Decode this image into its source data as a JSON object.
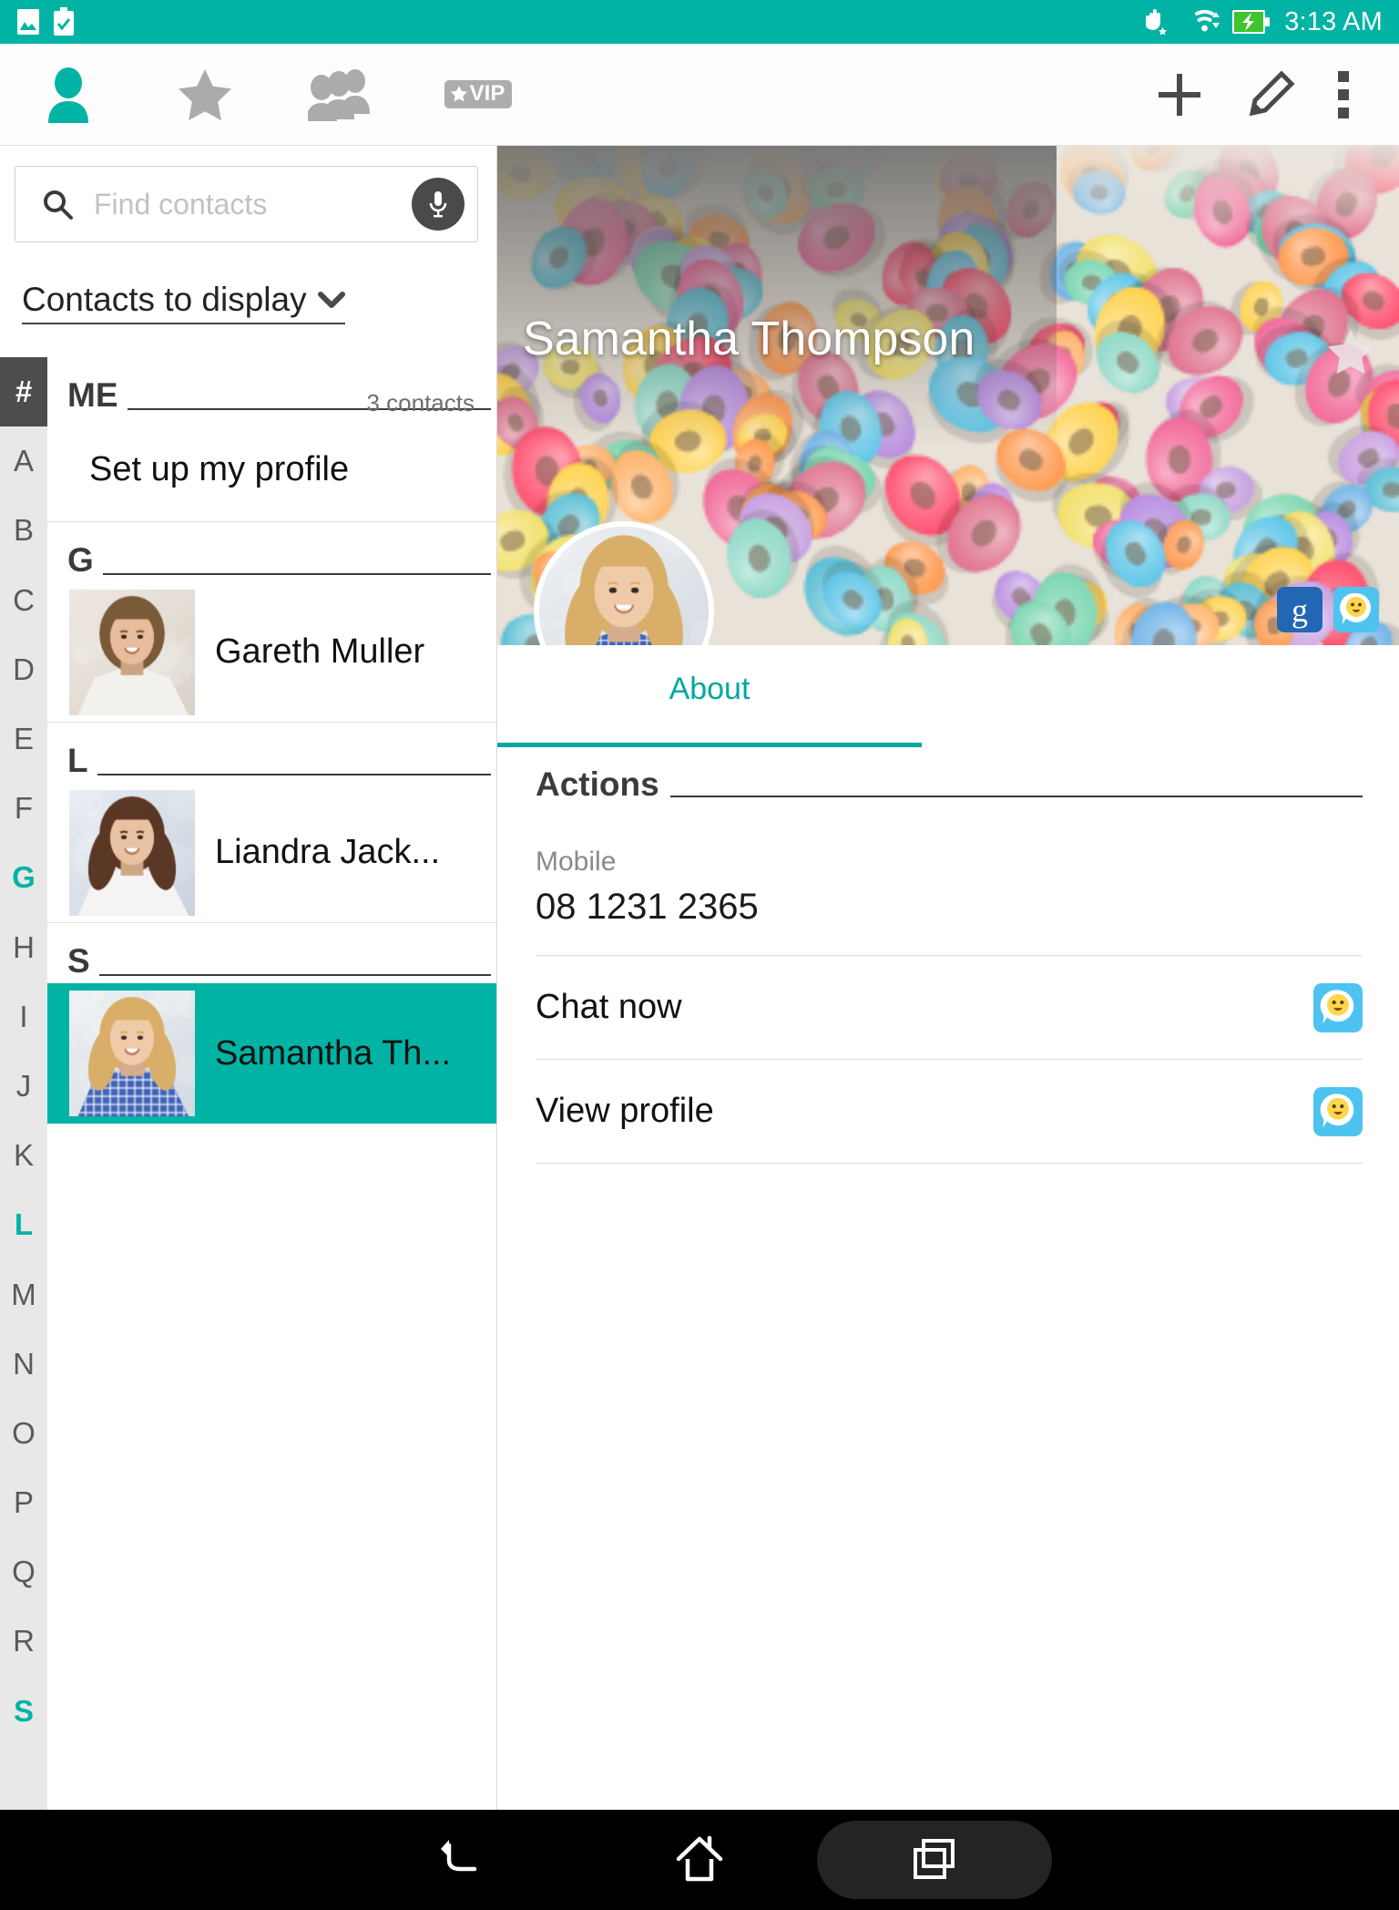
{
  "status_bar": {
    "icons": [
      "gallery-icon",
      "battery-saver-icon"
    ],
    "right_icons": [
      "glove-mode-icon",
      "wifi-icon",
      "battery-charging-icon"
    ],
    "time": "3:13 AM",
    "background_color": "#00B3A4"
  },
  "app_bar": {
    "tabs": [
      {
        "name": "contacts",
        "icon": "person-icon",
        "active": true
      },
      {
        "name": "favorites",
        "icon": "star-icon",
        "active": false
      },
      {
        "name": "groups",
        "icon": "people-icon",
        "active": false
      },
      {
        "name": "vip",
        "icon": "vip-badge-icon",
        "label": "VIP",
        "active": false
      }
    ],
    "actions": [
      {
        "name": "add-contact",
        "icon": "plus-icon"
      },
      {
        "name": "edit-contact",
        "icon": "pencil-icon"
      },
      {
        "name": "overflow-menu",
        "icon": "more-vertical-icon"
      }
    ],
    "accent_color": "#00B3A4"
  },
  "search": {
    "placeholder": "Find contacts",
    "value": "",
    "icon": "search-icon",
    "mic_icon": "microphone-icon"
  },
  "display_filter": {
    "label": "Contacts to display",
    "chevron": "chevron-down-icon"
  },
  "alpha_index": {
    "letters": [
      "#",
      "A",
      "B",
      "C",
      "D",
      "E",
      "F",
      "G",
      "H",
      "I",
      "J",
      "K",
      "L",
      "M",
      "N",
      "O",
      "P",
      "Q",
      "R",
      "S"
    ],
    "selected": [
      "G",
      "L",
      "S"
    ],
    "highlighted": "#",
    "accent_color": "#00B3A4"
  },
  "contact_list": {
    "sections": [
      {
        "letter": "ME",
        "count_label": "3 contacts",
        "items": [
          {
            "name": "Set up my profile",
            "has_photo": false
          }
        ]
      },
      {
        "letter": "G",
        "count_label": "",
        "items": [
          {
            "name": "Gareth Muller",
            "has_photo": true,
            "photo": "gareth"
          }
        ]
      },
      {
        "letter": "L",
        "count_label": "",
        "items": [
          {
            "name": "Liandra Jack...",
            "has_photo": true,
            "photo": "liandra"
          }
        ]
      },
      {
        "letter": "S",
        "count_label": "",
        "items": [
          {
            "name": "Samantha Th...",
            "has_photo": true,
            "photo": "samantha",
            "selected": true
          }
        ]
      }
    ],
    "selected_row_color": "#00B3A4"
  },
  "detail": {
    "hero_name": "Samantha Thompson",
    "hero_star_icon": "star-outline-icon",
    "hero_image": "colorful-cereal-loops-photo",
    "avatar": "samantha-avatar",
    "badges": [
      {
        "name": "google-account-badge",
        "icon": "google-g-icon"
      },
      {
        "name": "messenger-account-badge",
        "icon": "smiley-chat-icon"
      }
    ],
    "tabs": [
      {
        "label": "About",
        "active": true
      }
    ],
    "actions_title": "Actions",
    "mobile": {
      "label": "Mobile",
      "value": "08 1231 2365"
    },
    "action_rows": [
      {
        "label": "Chat now",
        "icon": "smiley-chat-icon"
      },
      {
        "label": "View profile",
        "icon": "smiley-chat-icon"
      }
    ],
    "accent_color": "#00A99D"
  },
  "nav_bar": {
    "buttons": [
      {
        "name": "back",
        "icon": "back-arrow-icon"
      },
      {
        "name": "home",
        "icon": "home-icon"
      },
      {
        "name": "recents",
        "icon": "recents-icon",
        "highlighted": true
      }
    ]
  }
}
